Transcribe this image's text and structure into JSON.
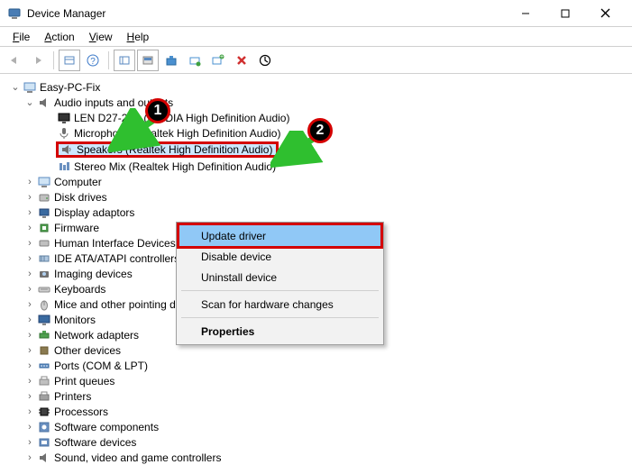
{
  "window": {
    "title": "Device Manager"
  },
  "menu": {
    "file": "File",
    "action": "Action",
    "view": "View",
    "help": "Help"
  },
  "tree": {
    "root": "Easy-PC-Fix",
    "audio": {
      "label": "Audio inputs and outputs",
      "items": [
        "LEN D27-20B (NVIDIA High Definition Audio)",
        "Microphone (Realtek High Definition Audio)",
        "Speakers (Realtek High Definition Audio)",
        "Stereo Mix (Realtek High Definition Audio)"
      ]
    },
    "cats": [
      "Computer",
      "Disk drives",
      "Display adaptors",
      "Firmware",
      "Human Interface Devices",
      "IDE ATA/ATAPI controllers",
      "Imaging devices",
      "Keyboards",
      "Mice and other pointing devices",
      "Monitors",
      "Network adapters",
      "Other devices",
      "Ports (COM & LPT)",
      "Print queues",
      "Printers",
      "Processors",
      "Software components",
      "Software devices",
      "Sound, video and game controllers"
    ]
  },
  "context": {
    "items": [
      "Update driver",
      "Disable device",
      "Uninstall device",
      "Scan for hardware changes",
      "Properties"
    ]
  },
  "badges": {
    "one": "1",
    "two": "2"
  }
}
